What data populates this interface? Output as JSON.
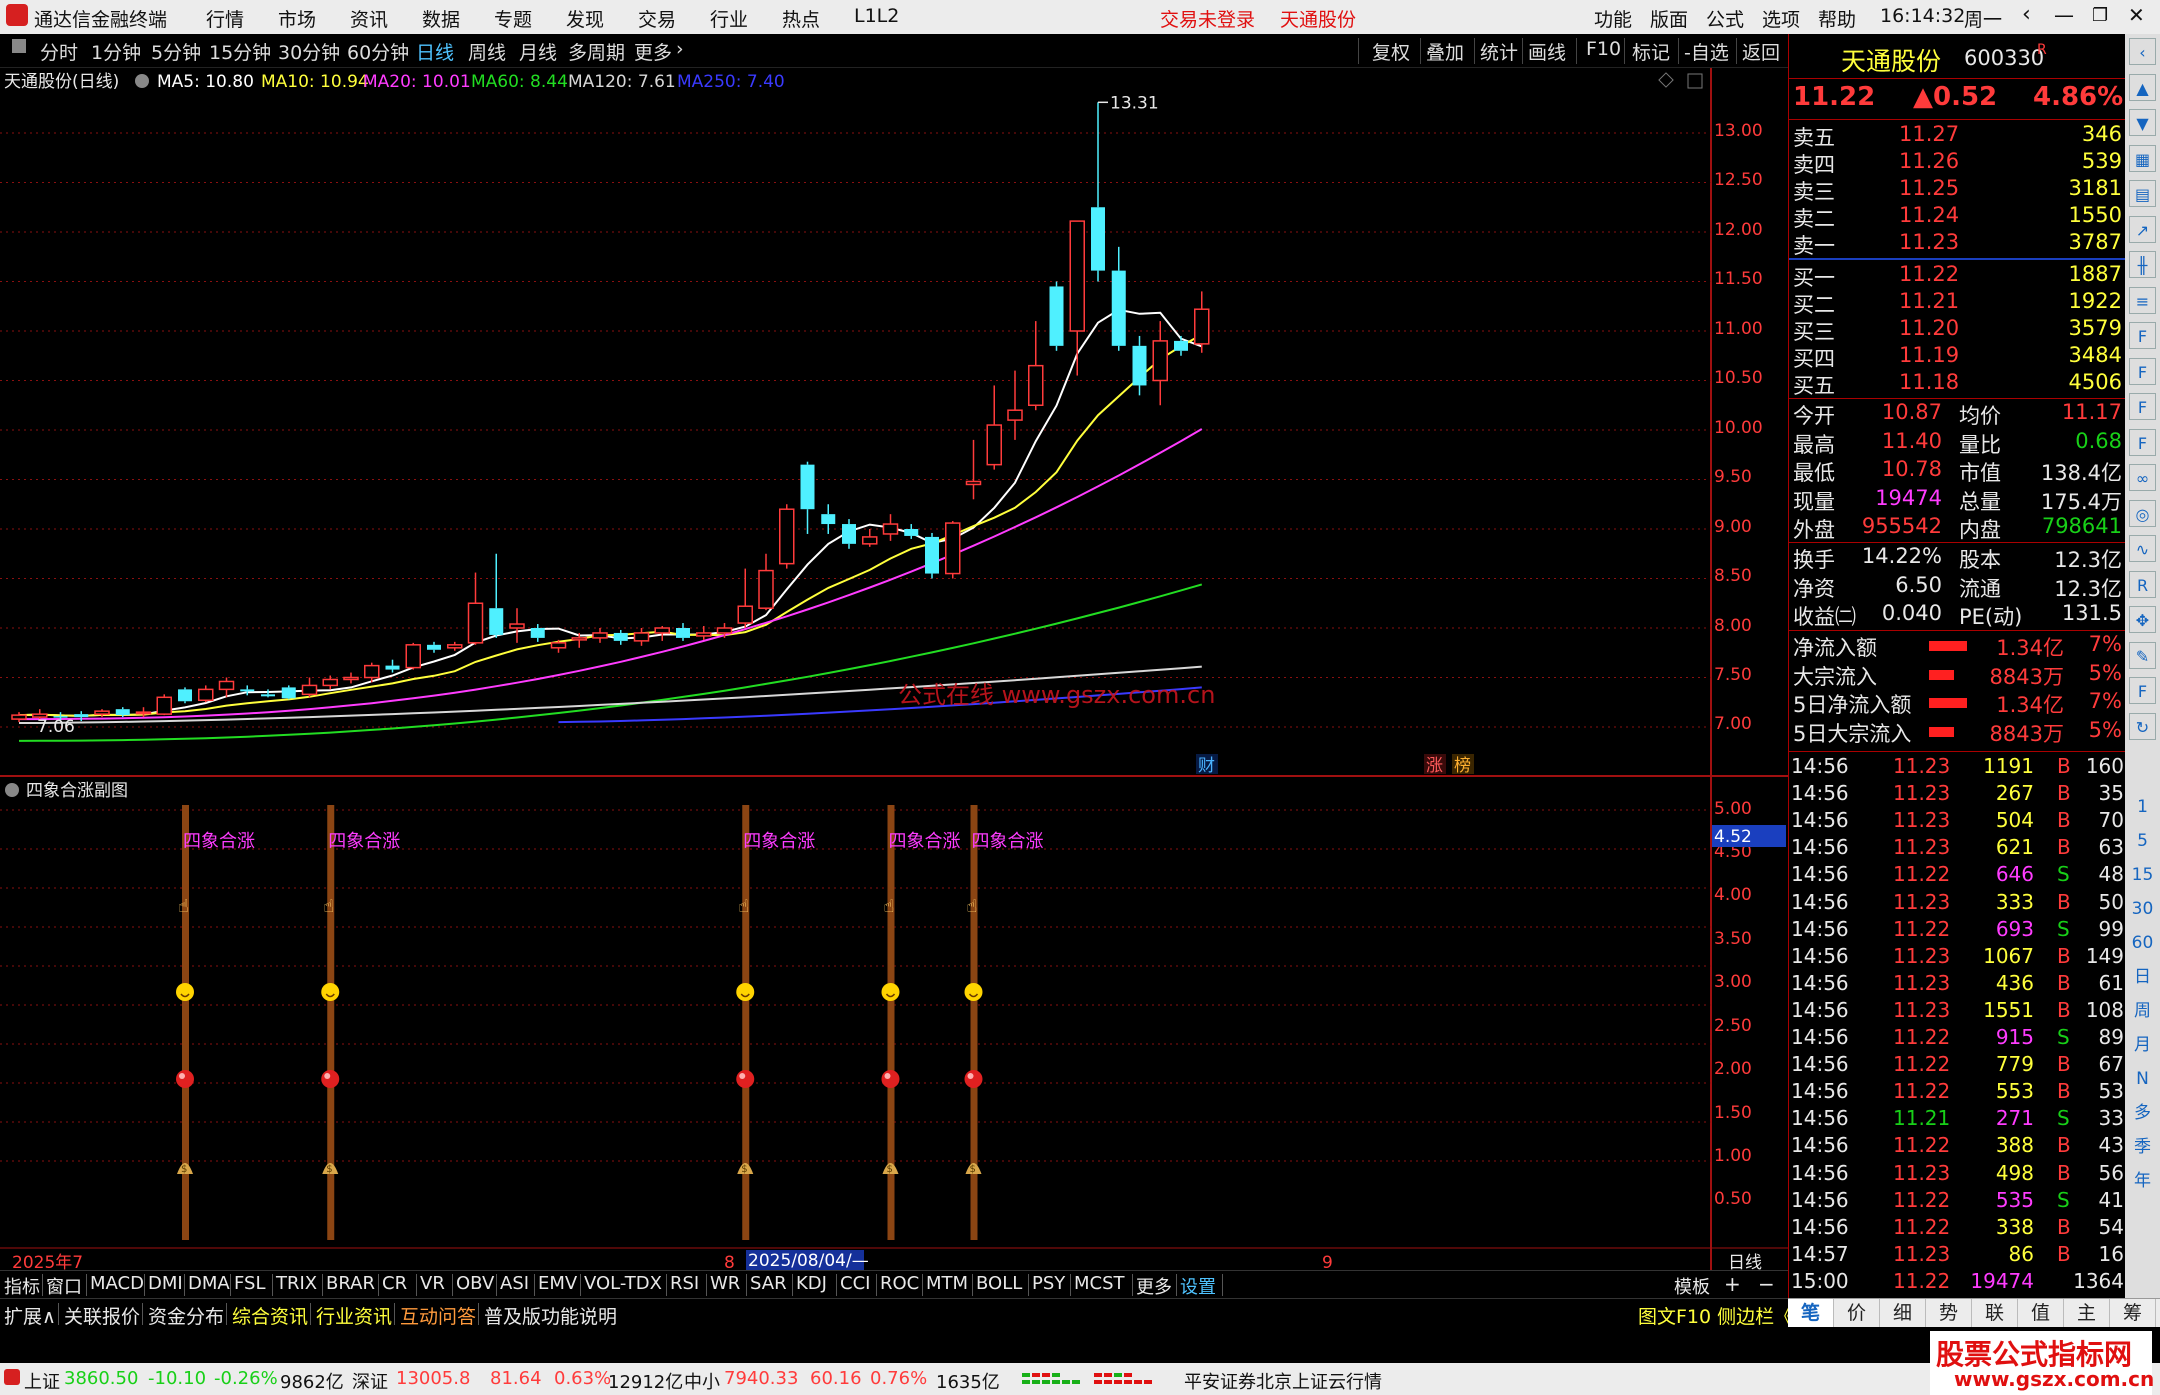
{
  "titlebar": {
    "app_title": "通达信金融终端",
    "menus": [
      "行情",
      "市场",
      "资讯",
      "数据",
      "专题",
      "发现",
      "交易",
      "行业",
      "热点",
      "L1L2"
    ],
    "trade_status": "交易未登录",
    "stock_name": "天通股份",
    "right_menus": [
      "功能",
      "版面",
      "公式",
      "选项",
      "帮助"
    ],
    "time": "16:14:32",
    "weekday": "周一"
  },
  "periods": {
    "items": [
      "分时",
      "1分钟",
      "5分钟",
      "15分钟",
      "30分钟",
      "60分钟",
      "日线",
      "周线",
      "月线",
      "多周期",
      "更多"
    ],
    "active": "日线",
    "tools": [
      "复权",
      "叠加",
      "统计",
      "画线",
      "F10",
      "标记",
      "-自选",
      "返回"
    ]
  },
  "main_chart": {
    "title": "天通股份(日线)",
    "ma": [
      {
        "label": "MA5: 10.80",
        "color": "#ffffff"
      },
      {
        "label": "MA10: 10.94",
        "color": "#ffff3c"
      },
      {
        "label": "MA20: 10.01",
        "color": "#ff3cff"
      },
      {
        "label": "MA60: 8.44",
        "color": "#22dd22"
      },
      {
        "label": "MA120: 7.61",
        "color": "#d8d8d8"
      },
      {
        "label": "MA250: 7.40",
        "color": "#3a3aff"
      }
    ],
    "high_label": "13.31",
    "low_label": "7.06",
    "watermark": "公式在线 www.gszx.com.cn",
    "markers": [
      {
        "text": "财",
        "color": "#4ab3ff"
      },
      {
        "text": "涨",
        "color": "#ff5a5a"
      },
      {
        "text": "榜",
        "color": "#ffb030"
      }
    ],
    "price_ticks": [
      "13.00",
      "12.50",
      "12.00",
      "11.50",
      "11.00",
      "10.50",
      "10.00",
      "9.50",
      "9.00",
      "8.50",
      "8.00",
      "7.50",
      "7.00"
    ]
  },
  "chart_data": {
    "type": "candlestick",
    "ylim": [
      6.8,
      13.45
    ],
    "candles": [
      {
        "o": 7.08,
        "c": 7.12,
        "h": 7.15,
        "l": 7.05
      },
      {
        "o": 7.1,
        "c": 7.13,
        "h": 7.18,
        "l": 7.08
      },
      {
        "o": 7.11,
        "c": 7.1,
        "h": 7.15,
        "l": 7.07
      },
      {
        "o": 7.13,
        "c": 7.1,
        "h": 7.16,
        "l": 7.06
      },
      {
        "o": 7.13,
        "c": 7.16,
        "h": 7.18,
        "l": 7.1
      },
      {
        "o": 7.18,
        "c": 7.12,
        "h": 7.2,
        "l": 7.1
      },
      {
        "o": 7.14,
        "c": 7.15,
        "h": 7.2,
        "l": 7.1
      },
      {
        "o": 7.13,
        "c": 7.3,
        "h": 7.33,
        "l": 7.12
      },
      {
        "o": 7.38,
        "c": 7.26,
        "h": 7.4,
        "l": 7.24
      },
      {
        "o": 7.27,
        "c": 7.38,
        "h": 7.42,
        "l": 7.25
      },
      {
        "o": 7.38,
        "c": 7.46,
        "h": 7.5,
        "l": 7.3
      },
      {
        "o": 7.38,
        "c": 7.36,
        "h": 7.42,
        "l": 7.32
      },
      {
        "o": 7.33,
        "c": 7.31,
        "h": 7.38,
        "l": 7.3
      },
      {
        "o": 7.4,
        "c": 7.29,
        "h": 7.42,
        "l": 7.28
      },
      {
        "o": 7.33,
        "c": 7.42,
        "h": 7.5,
        "l": 7.3
      },
      {
        "o": 7.42,
        "c": 7.48,
        "h": 7.52,
        "l": 7.38
      },
      {
        "o": 7.48,
        "c": 7.5,
        "h": 7.55,
        "l": 7.44
      },
      {
        "o": 7.5,
        "c": 7.62,
        "h": 7.65,
        "l": 7.45
      },
      {
        "o": 7.62,
        "c": 7.58,
        "h": 7.68,
        "l": 7.55
      },
      {
        "o": 7.6,
        "c": 7.83,
        "h": 7.85,
        "l": 7.58
      },
      {
        "o": 7.83,
        "c": 7.78,
        "h": 7.86,
        "l": 7.75
      },
      {
        "o": 7.8,
        "c": 7.83,
        "h": 7.86,
        "l": 7.77
      },
      {
        "o": 7.85,
        "c": 8.25,
        "h": 8.56,
        "l": 7.83
      },
      {
        "o": 8.2,
        "c": 7.93,
        "h": 8.75,
        "l": 7.9
      },
      {
        "o": 8.0,
        "c": 8.04,
        "h": 8.2,
        "l": 7.85
      },
      {
        "o": 8.0,
        "c": 7.9,
        "h": 8.04,
        "l": 7.86
      },
      {
        "o": 7.8,
        "c": 7.85,
        "h": 7.88,
        "l": 7.75
      },
      {
        "o": 7.88,
        "c": 7.9,
        "h": 7.95,
        "l": 7.8
      },
      {
        "o": 7.9,
        "c": 7.95,
        "h": 8.0,
        "l": 7.85
      },
      {
        "o": 7.95,
        "c": 7.87,
        "h": 7.98,
        "l": 7.83
      },
      {
        "o": 7.87,
        "c": 7.95,
        "h": 8.0,
        "l": 7.82
      },
      {
        "o": 7.95,
        "c": 8.0,
        "h": 8.02,
        "l": 7.87
      },
      {
        "o": 8.0,
        "c": 7.9,
        "h": 8.05,
        "l": 7.87
      },
      {
        "o": 7.92,
        "c": 7.95,
        "h": 8.02,
        "l": 7.88
      },
      {
        "o": 7.95,
        "c": 8.0,
        "h": 8.05,
        "l": 7.9
      },
      {
        "o": 8.05,
        "c": 8.22,
        "h": 8.6,
        "l": 8.0
      },
      {
        "o": 8.2,
        "c": 8.58,
        "h": 8.75,
        "l": 8.18
      },
      {
        "o": 8.65,
        "c": 9.2,
        "h": 9.25,
        "l": 8.6
      },
      {
        "o": 9.65,
        "c": 9.2,
        "h": 9.68,
        "l": 8.95
      },
      {
        "o": 9.15,
        "c": 9.05,
        "h": 9.25,
        "l": 8.95
      },
      {
        "o": 9.05,
        "c": 8.85,
        "h": 9.1,
        "l": 8.8
      },
      {
        "o": 8.85,
        "c": 8.92,
        "h": 9.0,
        "l": 8.82
      },
      {
        "o": 8.95,
        "c": 9.05,
        "h": 9.15,
        "l": 8.88
      },
      {
        "o": 9.0,
        "c": 8.93,
        "h": 9.05,
        "l": 8.9
      },
      {
        "o": 8.92,
        "c": 8.55,
        "h": 8.96,
        "l": 8.5
      },
      {
        "o": 8.55,
        "c": 9.06,
        "h": 9.08,
        "l": 8.5
      },
      {
        "o": 9.45,
        "c": 9.48,
        "h": 9.9,
        "l": 9.3
      },
      {
        "o": 9.65,
        "c": 10.05,
        "h": 10.45,
        "l": 9.6
      },
      {
        "o": 10.1,
        "c": 10.2,
        "h": 10.6,
        "l": 9.9
      },
      {
        "o": 10.25,
        "c": 10.65,
        "h": 11.1,
        "l": 10.2
      },
      {
        "o": 11.45,
        "c": 10.85,
        "h": 11.5,
        "l": 10.8
      },
      {
        "o": 11.0,
        "c": 12.11,
        "h": 12.11,
        "l": 10.55
      },
      {
        "o": 12.25,
        "c": 11.61,
        "h": 13.31,
        "l": 11.5
      },
      {
        "o": 11.61,
        "c": 10.85,
        "h": 11.85,
        "l": 10.8
      },
      {
        "o": 10.85,
        "c": 10.45,
        "h": 10.95,
        "l": 10.35
      },
      {
        "o": 10.5,
        "c": 10.9,
        "h": 11.1,
        "l": 10.25
      },
      {
        "o": 10.9,
        "c": 10.8,
        "h": 10.95,
        "l": 10.75
      },
      {
        "o": 10.87,
        "c": 11.22,
        "h": 11.4,
        "l": 10.78
      }
    ],
    "ma5_end": 10.8,
    "ma10_end": 10.94,
    "ma20_end": 10.01,
    "ma60_end": 8.44,
    "ma120_end": 7.61,
    "ma250_end": 7.4
  },
  "sub_chart": {
    "title": "四象合涨副图",
    "label": "四象合涨",
    "signal_positions": [
      8,
      15,
      35,
      42,
      46
    ],
    "ticks": [
      "5.00",
      "4.50",
      "4.00",
      "3.50",
      "3.00",
      "2.50",
      "2.00",
      "1.50",
      "1.00",
      "0.50"
    ],
    "value_tag": "4.52"
  },
  "xaxis": {
    "year": "2025年7",
    "mark8": "8",
    "date_tag": "2025/08/04/—",
    "mark9": "9",
    "period": "日线"
  },
  "quote": {
    "name": "天通股份",
    "code": "600330",
    "badge": "R",
    "price": "11.22",
    "change": "▲0.52",
    "pct": "4.86%",
    "asks": [
      {
        "label": "卖五",
        "price": "11.27",
        "vol": "346"
      },
      {
        "label": "卖四",
        "price": "11.26",
        "vol": "539"
      },
      {
        "label": "卖三",
        "price": "11.25",
        "vol": "3181"
      },
      {
        "label": "卖二",
        "price": "11.24",
        "vol": "1550"
      },
      {
        "label": "卖一",
        "price": "11.23",
        "vol": "3787"
      }
    ],
    "bids": [
      {
        "label": "买一",
        "price": "11.22",
        "vol": "1887"
      },
      {
        "label": "买二",
        "price": "11.21",
        "vol": "1922"
      },
      {
        "label": "买三",
        "price": "11.20",
        "vol": "3579"
      },
      {
        "label": "买四",
        "price": "11.19",
        "vol": "3484"
      },
      {
        "label": "买五",
        "price": "11.18",
        "vol": "4506"
      }
    ],
    "stats1": [
      {
        "l1": "今开",
        "v1": "10.87",
        "c1": "red",
        "l2": "均价",
        "v2": "11.17",
        "c2": "red"
      },
      {
        "l1": "最高",
        "v1": "11.40",
        "c1": "red",
        "l2": "量比",
        "v2": "0.68",
        "c2": "grn"
      },
      {
        "l1": "最低",
        "v1": "10.78",
        "c1": "red",
        "l2": "市值",
        "v2": "138.4亿",
        "c2": "wht"
      },
      {
        "l1": "现量",
        "v1": "19474",
        "c1": "mag",
        "l2": "总量",
        "v2": "175.4万",
        "c2": "wht"
      },
      {
        "l1": "外盘",
        "v1": "955542",
        "c1": "red",
        "l2": "内盘",
        "v2": "798641",
        "c2": "grn"
      }
    ],
    "stats2": [
      {
        "l1": "换手",
        "v1": "14.22%",
        "l2": "股本",
        "v2": "12.3亿"
      },
      {
        "l1": "净资",
        "v1": "6.50",
        "l2": "流通",
        "v2": "12.3亿"
      },
      {
        "l1": "收益㈡",
        "v1": "0.040",
        "l2": "PE(动)",
        "v2": "131.5"
      }
    ],
    "flows": [
      {
        "label": "净流入额",
        "val": "1.34亿",
        "pct": "7%",
        "bar": 1.0
      },
      {
        "label": "大宗流入",
        "val": "8843万",
        "pct": "5%",
        "bar": 0.66
      },
      {
        "label": "5日净流入额",
        "val": "1.34亿",
        "pct": "7%",
        "bar": 1.0
      },
      {
        "label": "5日大宗流入",
        "val": "8843万",
        "pct": "5%",
        "bar": 0.66
      }
    ],
    "ticks": [
      {
        "t": "14:56",
        "p": "11.23",
        "v": "1191",
        "s": "B",
        "n": "160"
      },
      {
        "t": "14:56",
        "p": "11.23",
        "v": "267",
        "s": "B",
        "n": "35"
      },
      {
        "t": "14:56",
        "p": "11.23",
        "v": "504",
        "s": "B",
        "n": "70"
      },
      {
        "t": "14:56",
        "p": "11.23",
        "v": "621",
        "s": "B",
        "n": "63"
      },
      {
        "t": "14:56",
        "p": "11.22",
        "v": "646",
        "s": "S",
        "n": "48"
      },
      {
        "t": "14:56",
        "p": "11.23",
        "v": "333",
        "s": "B",
        "n": "50"
      },
      {
        "t": "14:56",
        "p": "11.22",
        "v": "693",
        "s": "S",
        "n": "99"
      },
      {
        "t": "14:56",
        "p": "11.23",
        "v": "1067",
        "s": "B",
        "n": "149"
      },
      {
        "t": "14:56",
        "p": "11.23",
        "v": "436",
        "s": "B",
        "n": "61"
      },
      {
        "t": "14:56",
        "p": "11.23",
        "v": "1551",
        "s": "B",
        "n": "108"
      },
      {
        "t": "14:56",
        "p": "11.22",
        "v": "915",
        "s": "S",
        "n": "89"
      },
      {
        "t": "14:56",
        "p": "11.22",
        "v": "779",
        "s": "B",
        "n": "67"
      },
      {
        "t": "14:56",
        "p": "11.22",
        "v": "553",
        "s": "B",
        "n": "53"
      },
      {
        "t": "14:56",
        "p": "11.21",
        "v": "271",
        "s": "S",
        "n": "33"
      },
      {
        "t": "14:56",
        "p": "11.22",
        "v": "388",
        "s": "B",
        "n": "43"
      },
      {
        "t": "14:56",
        "p": "11.23",
        "v": "498",
        "s": "B",
        "n": "56"
      },
      {
        "t": "14:56",
        "p": "11.22",
        "v": "535",
        "s": "S",
        "n": "41"
      },
      {
        "t": "14:56",
        "p": "11.22",
        "v": "338",
        "s": "B",
        "n": "54"
      },
      {
        "t": "14:57",
        "p": "11.23",
        "v": "86",
        "s": "B",
        "n": "16"
      },
      {
        "t": "15:00",
        "p": "11.22",
        "v": "19474",
        "s": "",
        "n": "1364"
      }
    ]
  },
  "indicator_bar": {
    "items": [
      "指标",
      "窗口",
      "MACD",
      "DMI",
      "DMA",
      "FSL",
      "TRIX",
      "BRAR",
      "CR",
      "VR",
      "OBV",
      "ASI",
      "EMV",
      "VOL-TDX",
      "RSI",
      "WR",
      "SAR",
      "KDJ",
      "CCI",
      "ROC",
      "MTM",
      "BOLL",
      "PSY",
      "MCST",
      "更多",
      "设置"
    ],
    "right": [
      "模板",
      "+",
      "−"
    ]
  },
  "expand_bar": {
    "items": [
      "扩展∧",
      "关联报价",
      "资金分布",
      "综合资讯",
      "行业资讯",
      "互动问答",
      "普及版功能说明"
    ],
    "right": "图文F10 侧边栏《"
  },
  "right_tabs": [
    "笔",
    "价",
    "细",
    "势",
    "联",
    "值",
    "主",
    "筹"
  ],
  "side_icons": [
    "chevron-left-icon",
    "up-icon",
    "down-icon",
    "grid-icon",
    "table-icon",
    "line-icon",
    "candle-icon",
    "list-icon",
    "f10-icon",
    "f2-icon",
    "f1-icon",
    "fz-icon",
    "link-icon",
    "circle-icon",
    "wave-icon",
    "rsi-icon",
    "cross-icon",
    "pen-icon",
    "f5-icon",
    "refresh-icon"
  ],
  "side_text": [
    "1",
    "5",
    "15",
    "30",
    "60",
    "日",
    "周",
    "月",
    "N",
    "多",
    "季",
    "年"
  ],
  "status": {
    "items": [
      {
        "name": "上证",
        "val": "3860.50",
        "chg": "-10.10",
        "pct": "-0.26%",
        "amt": "9862亿",
        "color": "grn"
      },
      {
        "name": "深证",
        "val": "13005.8",
        "chg": "81.64",
        "pct": "0.63%",
        "amt": "12912亿",
        "color": "red"
      },
      {
        "name": "中小",
        "val": "7940.33",
        "chg": "60.16",
        "pct": "0.76%",
        "amt": "1635亿",
        "color": "red"
      }
    ],
    "broker": "平安证券北京上证云行情",
    "brand": "股票公式指标网",
    "brand_url": "www.gszx.com.cn"
  }
}
